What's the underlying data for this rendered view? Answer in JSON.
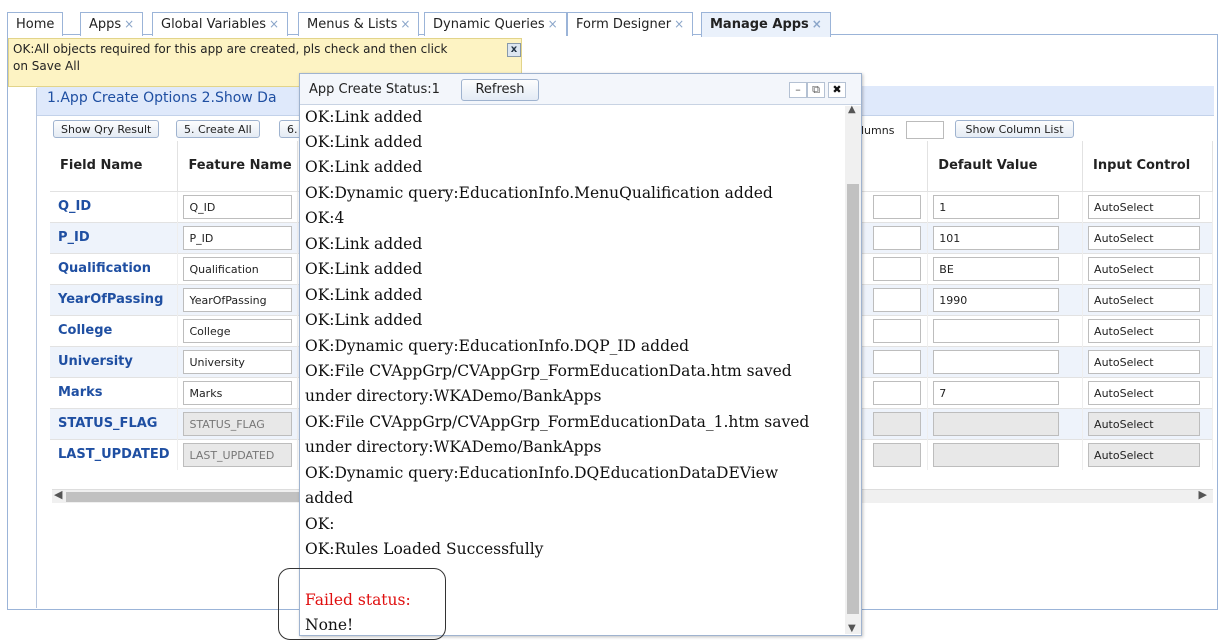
{
  "tabs": [
    {
      "label": "Home",
      "closable": false
    },
    {
      "label": "Apps",
      "closable": true
    },
    {
      "label": "Global Variables",
      "closable": true
    },
    {
      "label": "Menus & Lists",
      "closable": true
    },
    {
      "label": "Dynamic Queries",
      "closable": true
    },
    {
      "label": "Form Designer",
      "closable": true
    },
    {
      "label": "Manage Apps",
      "closable": true,
      "active": true
    }
  ],
  "close_glyph": "×",
  "toast": {
    "line1": "OK:All objects required for this app are created, pls check and then click",
    "line2": "on Save All",
    "close": "x"
  },
  "options_bar": {
    "text": "1.App Create Options  2.Show Da"
  },
  "buttons": {
    "show_qry": "Show Qry Result",
    "create_all": "5. Create All",
    "six": "6.",
    "show_col_list": "Show Column List",
    "columns_label": "lumns"
  },
  "grid": {
    "headers": {
      "field": "Field Name",
      "feature": "Feature Name",
      "default": "Default Value",
      "input": "Input Control"
    },
    "rows": [
      {
        "field": "Q_ID",
        "feature": "Q_ID",
        "default": "1",
        "input": "AutoSelect",
        "disabled": false
      },
      {
        "field": "P_ID",
        "feature": "P_ID",
        "default": "101",
        "input": "AutoSelect",
        "disabled": false
      },
      {
        "field": "Qualification",
        "feature": "Qualification",
        "default": "BE",
        "input": "AutoSelect",
        "disabled": false
      },
      {
        "field": "YearOfPassing",
        "feature": "YearOfPassing",
        "default": "1990",
        "input": "AutoSelect",
        "disabled": false
      },
      {
        "field": "College",
        "feature": "College",
        "default": "",
        "input": "AutoSelect",
        "disabled": false
      },
      {
        "field": "University",
        "feature": "University",
        "default": "",
        "input": "AutoSelect",
        "disabled": false
      },
      {
        "field": "Marks",
        "feature": "Marks",
        "default": "7",
        "input": "AutoSelect",
        "disabled": false
      },
      {
        "field": "STATUS_FLAG",
        "feature": "STATUS_FLAG",
        "default": "",
        "input": "AutoSelect",
        "disabled": true
      },
      {
        "field": "LAST_UPDATED",
        "feature": "LAST_UPDATED",
        "default": "",
        "input": "AutoSelect",
        "disabled": true
      }
    ]
  },
  "dialog": {
    "title": "App Create Status:1",
    "refresh": "Refresh",
    "minimize": "–",
    "restore": "⧉",
    "close": "✖",
    "lines": [
      "OK:Link added",
      "OK:Link added",
      "OK:Link added",
      "OK:Dynamic query:EducationInfo.MenuQualification added",
      "OK:4",
      "OK:Link added",
      "OK:Link added",
      "OK:Link added",
      "OK:Link added",
      "OK:Dynamic query:EducationInfo.DQP_ID added",
      "OK:File CVAppGrp/CVAppGrp_FormEducationData.htm saved",
      "under directory:WKADemo/BankApps",
      "OK:File CVAppGrp/CVAppGrp_FormEducationData_1.htm saved",
      "under directory:WKADemo/BankApps",
      "OK:Dynamic query:EducationInfo.DQEducationDataDEView",
      "added",
      "OK:",
      "OK:Rules Loaded Successfully",
      "",
      "Failed status:",
      "None!"
    ]
  }
}
